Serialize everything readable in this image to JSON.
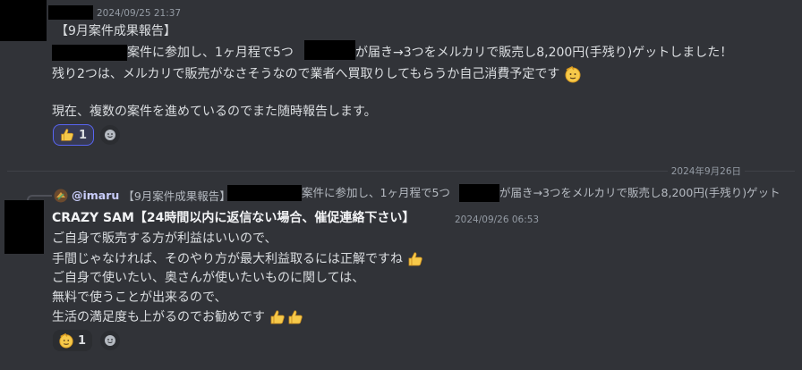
{
  "message1": {
    "timestamp": "2024/09/25 21:37",
    "title": "【9月案件成果報告】",
    "line1_part1": "案件に参加し、1ヶ月程で5つ",
    "line1_part2": "が届き→3つをメルカリで販売し8,200円(手残り)ゲットしました！",
    "line2": "残り2つは、メルカリで販売がなさそうなので業者へ買取りしてもらうか自己消費予定です",
    "line3": "現在、複数の案件を進めているのでまた随時報告します。",
    "reactions": [
      {
        "emoji": "thumbs-up",
        "count": "1"
      }
    ]
  },
  "divider_date": "2024年9月26日",
  "message2": {
    "reply": {
      "username": "@imaru",
      "preview_part1": "【9月案件成果報告】",
      "preview_part2": "案件に参加し、1ヶ月程で5つ",
      "preview_part3": "が届き→3つをメルカリで販売し8,200円(手残り)ゲット"
    },
    "author": "CRAZY SAM【24時間以内に返信ない場合、催促連絡下さい】",
    "timestamp": "2024/09/26 06:53",
    "lines": [
      "ご自身で販売する方が利益はいいので、",
      "手間じゃなければ、そのやり方が最大利益取るには正解ですね",
      "ご自身で使いたい、奥さんが使いたいものに関しては、",
      "無料で使うことが出来るので、",
      "生活の満足度も上がるのでお勧めです"
    ],
    "reactions": [
      {
        "emoji": "saluting-face",
        "count": "1"
      }
    ]
  }
}
